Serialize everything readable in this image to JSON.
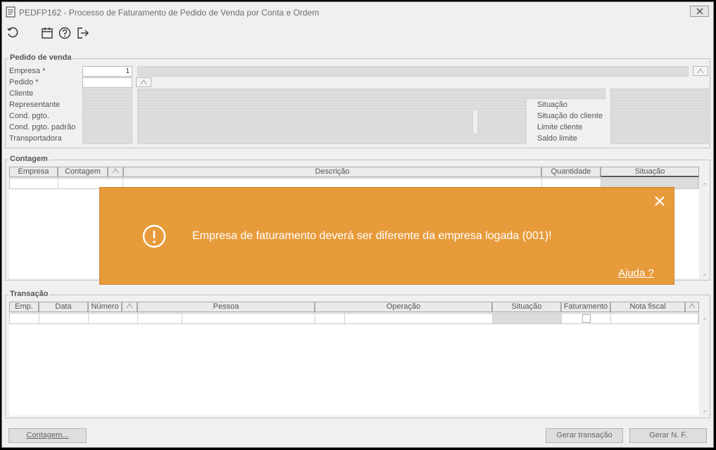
{
  "window": {
    "title": "PEDFP162 - Processo de Faturamento de Pedido de Venda por Conta e Ordem"
  },
  "toolbar": {
    "icons": [
      "refresh-icon",
      "calendar-icon",
      "help-icon",
      "exit-icon"
    ]
  },
  "pedido": {
    "group_title": "Pedido de venda",
    "labels": {
      "empresa": "Empresa *",
      "pedido": "Pedido *",
      "cliente": "Cliente",
      "representante": "Representante",
      "cond_pgto": "Cond. pgto.",
      "cond_pgto_padrao": "Cond. pgto. padrão",
      "transportadora": "Transportadora",
      "situacao": "Situação",
      "situacao_cliente": "Situação do cliente",
      "limite_cliente": "Limite cliente",
      "saldo_limite": "Saldo limite"
    },
    "empresa_value": "1"
  },
  "contagem": {
    "group_title": "Contagem",
    "columns": [
      "Empresa",
      "Contagem",
      "Descrição",
      "Quantidade",
      "Situação"
    ]
  },
  "transacao": {
    "group_title": "Transação",
    "columns": [
      "Emp.",
      "Data",
      "Número",
      "Pessoa",
      "Operação",
      "Situação",
      "Faturamento",
      "Nota fiscal"
    ]
  },
  "toast": {
    "message": "Empresa de faturamento deverá ser diferente da empresa logada (001)!",
    "help_link": "Ajuda ?",
    "color": "#e89b3b"
  },
  "buttons": {
    "contagem": "Contagem...",
    "gerar_transacao": "Gerar transação",
    "gerar_nf": "Gerar N. F."
  }
}
